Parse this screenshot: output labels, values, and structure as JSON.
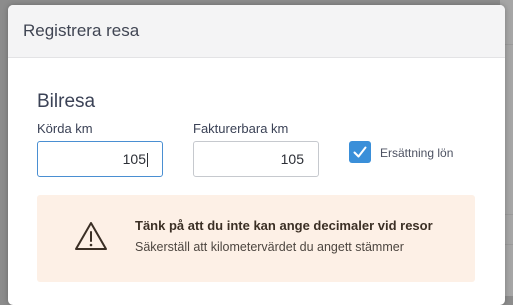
{
  "modal": {
    "title": "Registrera resa",
    "section_title": "Bilresa",
    "driven_km": {
      "label": "Körda km",
      "value": "105"
    },
    "billable_km": {
      "label": "Fakturerbara km",
      "value": "105"
    },
    "salary_compensation": {
      "label": "Ersättning lön",
      "checked": true
    },
    "warning": {
      "icon": "warning-triangle-icon",
      "title": "Tänk på att du inte kan ange decimaler vid resor",
      "body": "Säkerställ att kilometervärdet du angett stämmer"
    }
  },
  "colors": {
    "accent": "#3a8fd9",
    "warning_bg": "#fdf0e6"
  }
}
